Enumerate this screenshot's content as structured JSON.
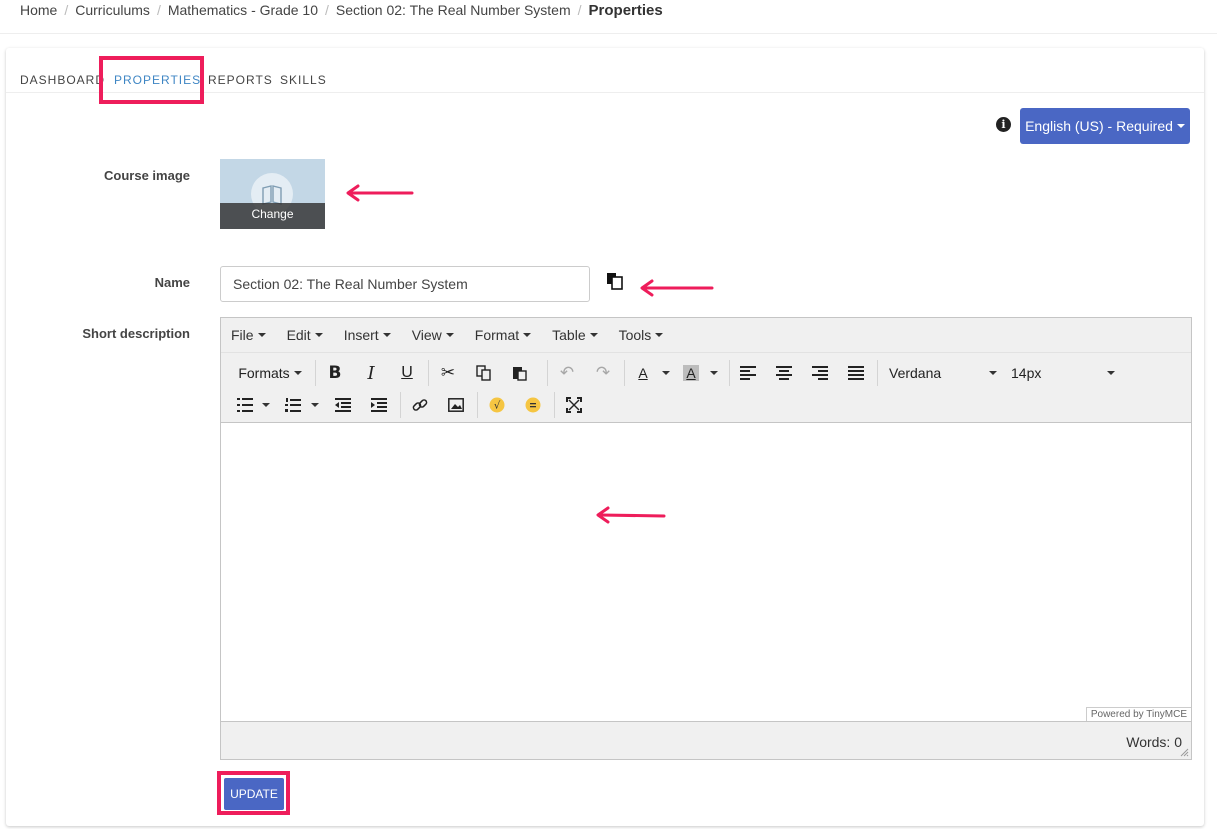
{
  "breadcrumb": {
    "items": [
      "Home",
      "Curriculums",
      "Mathematics - Grade 10",
      "Section 02: The Real Number System"
    ],
    "current": "Properties"
  },
  "tabs": [
    "DASHBOARD",
    "PROPERTIES",
    "REPORTS",
    "SKILLS"
  ],
  "active_tab": "PROPERTIES",
  "language": {
    "label": "English (US) - Required"
  },
  "form": {
    "course_image_label": "Course image",
    "change_label": "Change",
    "name_label": "Name",
    "name_value": "Section 02: The Real Number System",
    "short_description_label": "Short description"
  },
  "editor": {
    "menu": [
      "File",
      "Edit",
      "Insert",
      "View",
      "Format",
      "Table",
      "Tools"
    ],
    "formats_label": "Formats",
    "font_family": "Verdana",
    "font_size": "14px",
    "powered_by": "Powered by TinyMCE",
    "words": "Words: 0"
  },
  "update_label": "UPDATE",
  "colors": {
    "accent": "#4a67c4",
    "highlight": "#ee1d5b",
    "active_tab": "#3f86c4"
  }
}
